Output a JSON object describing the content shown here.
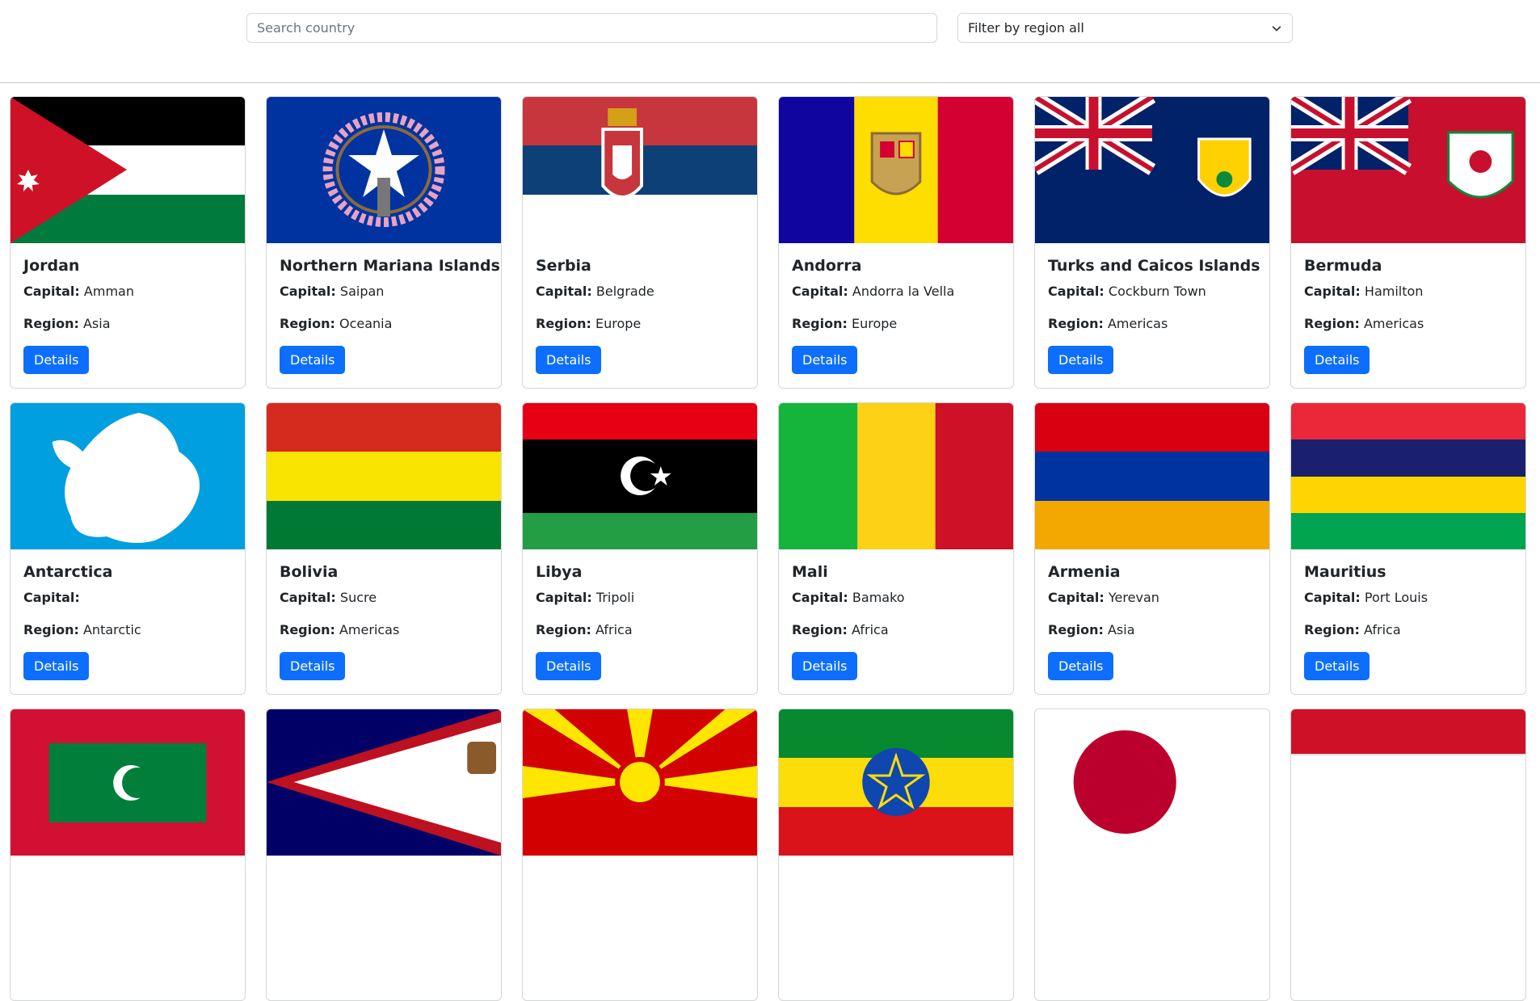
{
  "search": {
    "placeholder": "Search country",
    "value": ""
  },
  "filter": {
    "label": "Filter by region all"
  },
  "labels": {
    "capital": "Capital:",
    "region": "Region:",
    "details": "Details"
  },
  "countries": [
    {
      "name": "Jordan",
      "capital": "Amman",
      "region": "Asia",
      "flag": "jordan-flag"
    },
    {
      "name": "Northern Mariana Islands",
      "capital": "Saipan",
      "region": "Oceania",
      "flag": "northern-mariana-islands-flag"
    },
    {
      "name": "Serbia",
      "capital": "Belgrade",
      "region": "Europe",
      "flag": "serbia-flag"
    },
    {
      "name": "Andorra",
      "capital": "Andorra la Vella",
      "region": "Europe",
      "flag": "andorra-flag"
    },
    {
      "name": "Turks and Caicos Islands",
      "capital": "Cockburn Town",
      "region": "Americas",
      "flag": "turks-and-caicos-flag"
    },
    {
      "name": "Bermuda",
      "capital": "Hamilton",
      "region": "Americas",
      "flag": "bermuda-flag"
    },
    {
      "name": "Antarctica",
      "capital": "",
      "region": "Antarctic",
      "flag": "antarctica-flag"
    },
    {
      "name": "Bolivia",
      "capital": "Sucre",
      "region": "Americas",
      "flag": "bolivia-flag"
    },
    {
      "name": "Libya",
      "capital": "Tripoli",
      "region": "Africa",
      "flag": "libya-flag"
    },
    {
      "name": "Mali",
      "capital": "Bamako",
      "region": "Africa",
      "flag": "mali-flag"
    },
    {
      "name": "Armenia",
      "capital": "Yerevan",
      "region": "Asia",
      "flag": "armenia-flag"
    },
    {
      "name": "Mauritius",
      "capital": "Port Louis",
      "region": "Africa",
      "flag": "mauritius-flag"
    },
    {
      "name": "",
      "capital": "",
      "region": "",
      "flag": "maldives-flag"
    },
    {
      "name": "",
      "capital": "",
      "region": "",
      "flag": "american-samoa-flag"
    },
    {
      "name": "",
      "capital": "",
      "region": "",
      "flag": "north-macedonia-flag"
    },
    {
      "name": "",
      "capital": "",
      "region": "",
      "flag": "ethiopia-flag"
    },
    {
      "name": "",
      "capital": "",
      "region": "",
      "flag": "japan-flag"
    },
    {
      "name": "",
      "capital": "",
      "region": "",
      "flag": "red-white-flag"
    }
  ],
  "colors": {
    "accent": "#0d6efd"
  }
}
